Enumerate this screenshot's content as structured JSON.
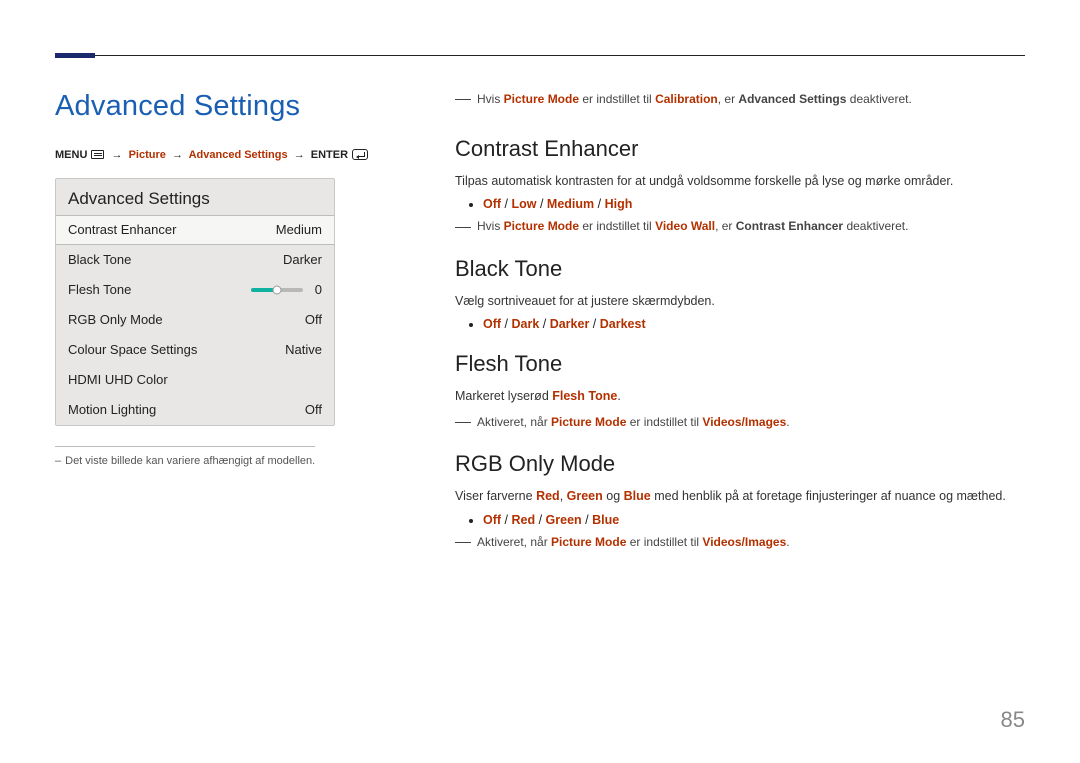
{
  "page_number": "85",
  "left": {
    "title": "Advanced Settings",
    "breadcrumb": {
      "menu": "MENU",
      "picture": "Picture",
      "advanced": "Advanced Settings",
      "enter": "ENTER"
    },
    "panel": {
      "title": "Advanced Settings",
      "rows": {
        "contrast_enhancer": {
          "label": "Contrast Enhancer",
          "value": "Medium"
        },
        "black_tone": {
          "label": "Black Tone",
          "value": "Darker"
        },
        "flesh_tone": {
          "label": "Flesh Tone",
          "value": "0"
        },
        "rgb_only": {
          "label": "RGB Only Mode",
          "value": "Off"
        },
        "colour_space": {
          "label": "Colour Space Settings",
          "value": "Native"
        },
        "hdmi_uhd": {
          "label": "HDMI UHD Color",
          "value": ""
        },
        "motion_lighting": {
          "label": "Motion Lighting",
          "value": "Off"
        }
      }
    },
    "panel_note": "Det viste billede kan variere afhængigt af modellen."
  },
  "right": {
    "top_note": {
      "pre": "Hvis ",
      "t1": "Picture Mode",
      "mid1": " er indstillet til ",
      "t2": "Calibration",
      "mid2": ", er ",
      "t3": "Advanced Settings",
      "post": " deaktiveret."
    },
    "contrast": {
      "h": "Contrast Enhancer",
      "p": "Tilpas automatisk kontrasten for at undgå voldsomme forskelle på lyse og mørke områder.",
      "opts": {
        "off": "Off",
        "low": "Low",
        "medium": "Medium",
        "high": "High"
      },
      "note": {
        "pre": "Hvis ",
        "t1": "Picture Mode",
        "mid1": " er indstillet til ",
        "t2": "Video Wall",
        "mid2": ", er ",
        "t3": "Contrast Enhancer",
        "post": " deaktiveret."
      }
    },
    "black": {
      "h": "Black Tone",
      "p": "Vælg sortniveauet for at justere skærmdybden.",
      "opts": {
        "off": "Off",
        "dark": "Dark",
        "darker": "Darker",
        "darkest": "Darkest"
      }
    },
    "flesh": {
      "h": "Flesh Tone",
      "p_pre": "Markeret lyserød ",
      "p_accent": "Flesh Tone",
      "p_post": ".",
      "note": {
        "pre": "Aktiveret, når ",
        "t1": "Picture Mode",
        "mid": " er indstillet til ",
        "t2": "Videos/Images",
        "post": "."
      }
    },
    "rgb": {
      "h": "RGB Only Mode",
      "p_pre": "Viser farverne ",
      "red": "Red",
      "c1": ", ",
      "green": "Green",
      "c2": " og ",
      "blue": "Blue",
      "p_post": " med henblik på at foretage finjusteringer af nuance og mæthed.",
      "opts": {
        "off": "Off",
        "r": "Red",
        "g": "Green",
        "b": "Blue"
      },
      "note": {
        "pre": "Aktiveret, når ",
        "t1": "Picture Mode",
        "mid": " er indstillet til ",
        "t2": "Videos/Images",
        "post": "."
      }
    }
  }
}
